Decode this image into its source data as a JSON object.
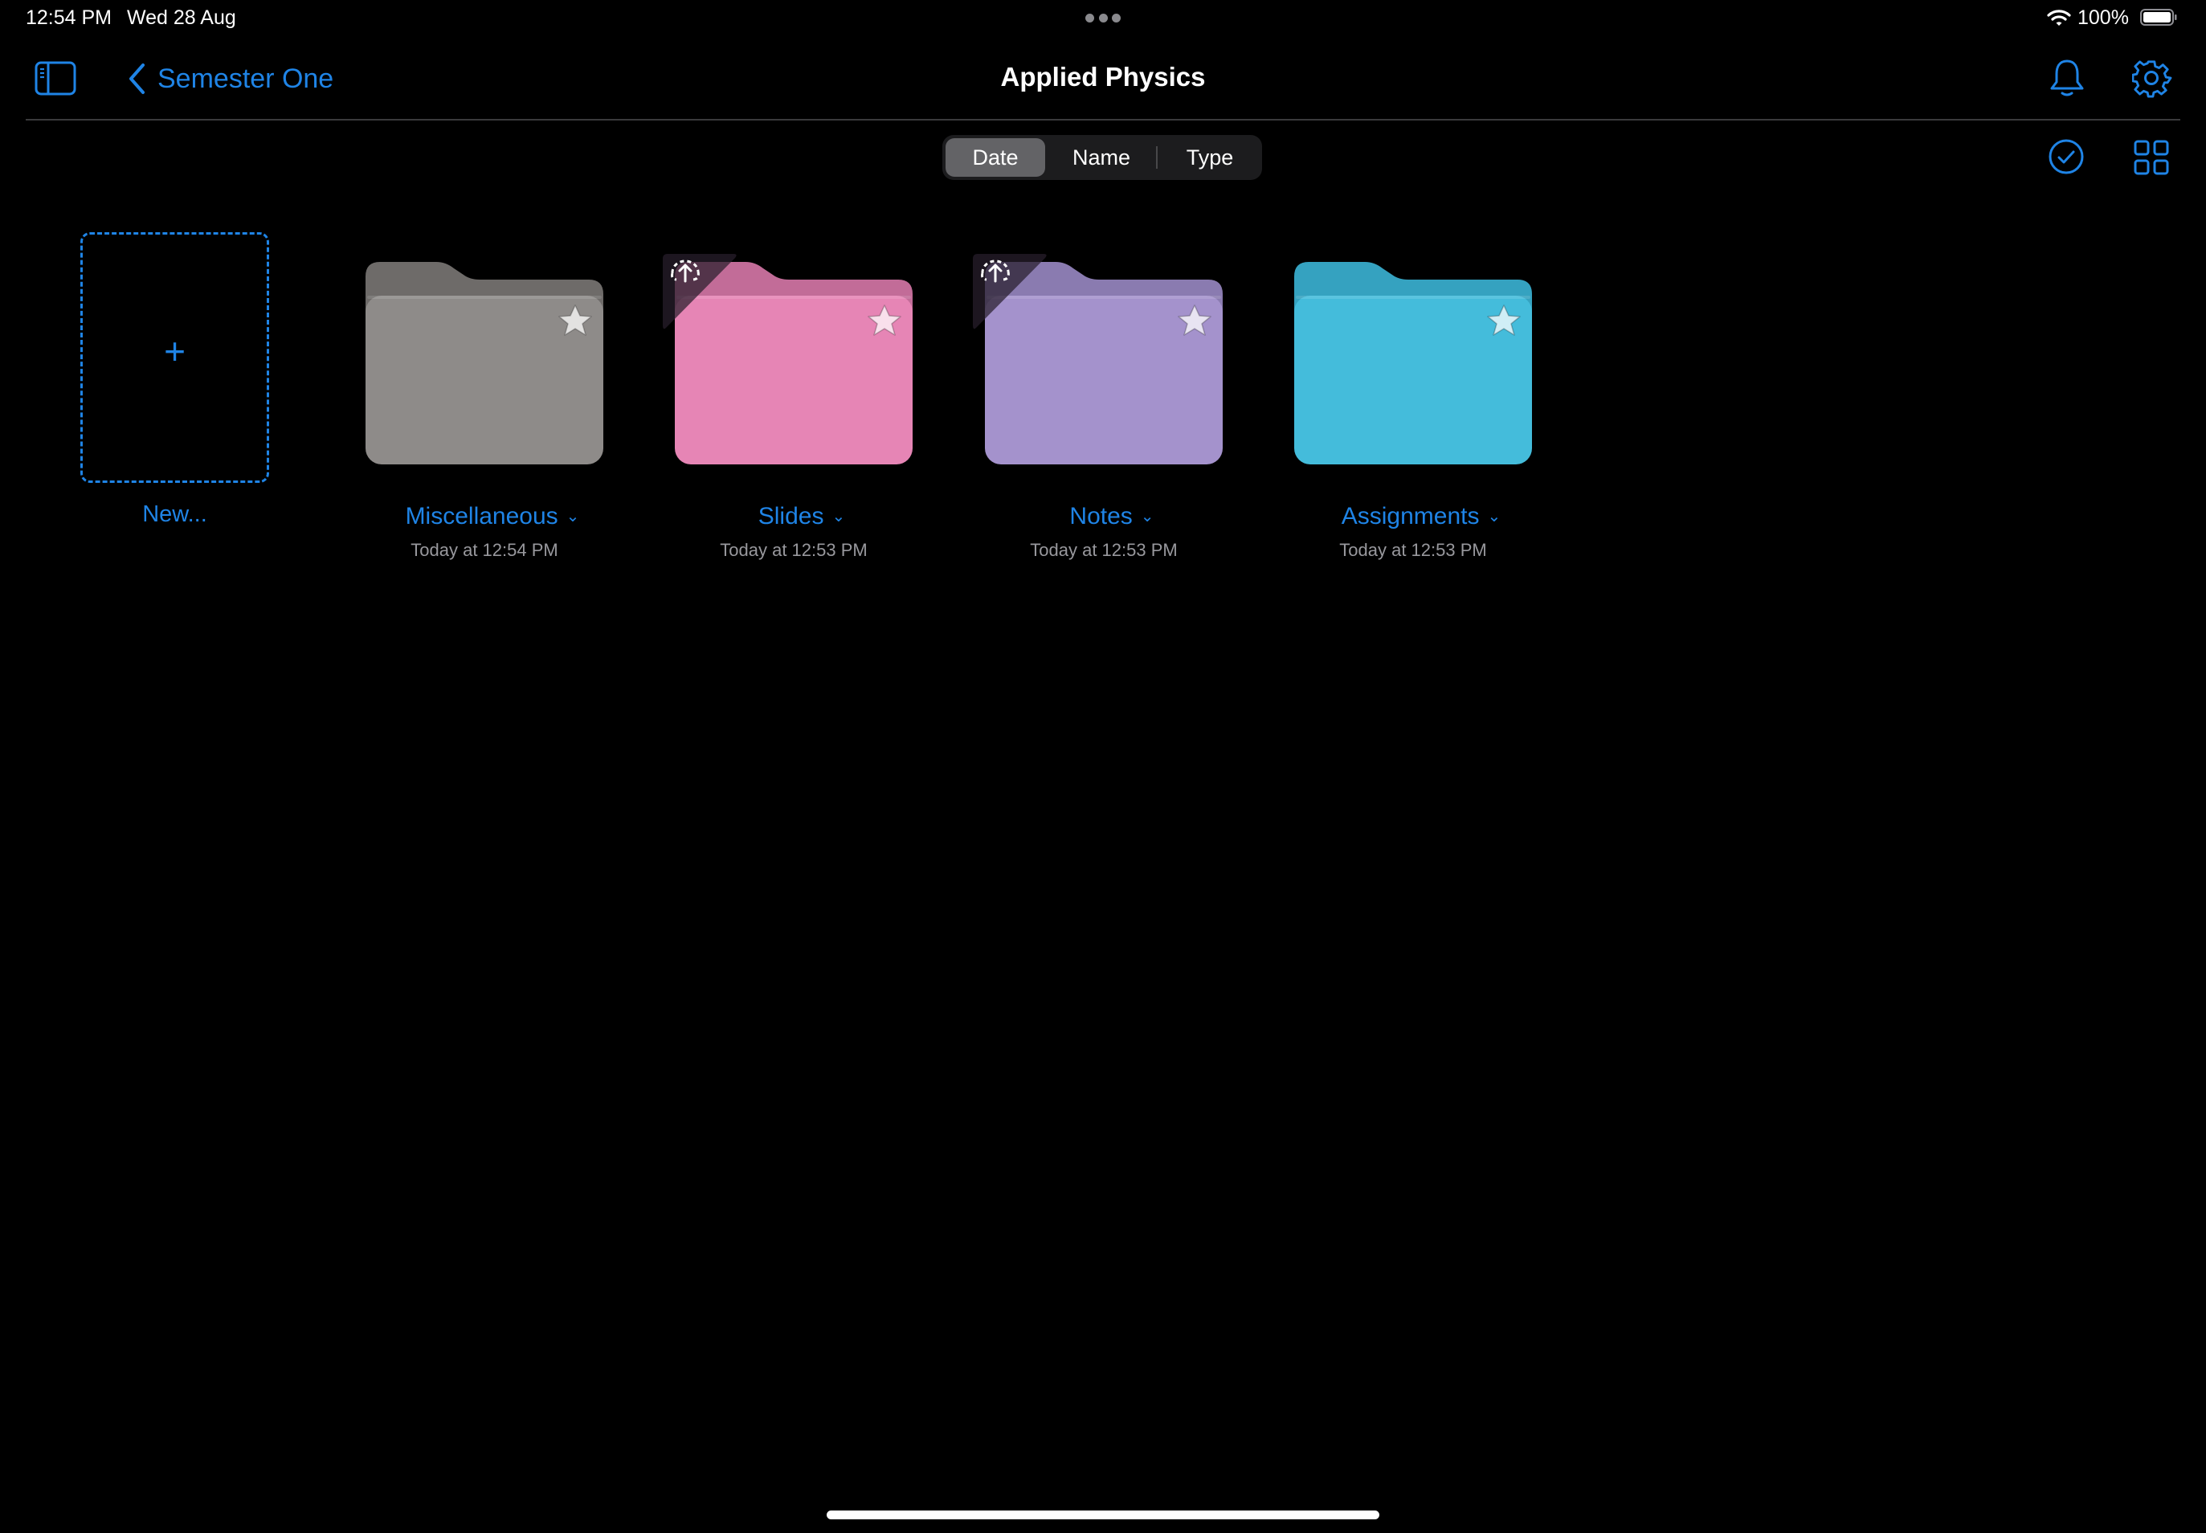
{
  "status_bar": {
    "time": "12:54 PM",
    "date": "Wed 28 Aug",
    "battery": "100%",
    "icons": [
      "multitasking-dots-icon",
      "wifi-icon",
      "battery-icon"
    ]
  },
  "nav": {
    "back_label": "Semester One",
    "title": "Applied Physics",
    "icons": [
      "sidebar-toggle-icon",
      "chevron-left-icon",
      "bell-icon",
      "gear-icon"
    ]
  },
  "toolbar": {
    "sort_options": [
      "Date",
      "Name",
      "Type"
    ],
    "sort_selected": "Date",
    "icons": [
      "checkmark-circle-icon",
      "grid-view-icon"
    ]
  },
  "new_tile": {
    "plus": "+",
    "label": "New..."
  },
  "folders": [
    {
      "name": "Miscellaneous",
      "date": "Today at 12:54 PM",
      "color": "#8e8b89",
      "back_color": "#6e6b69",
      "uploading": false,
      "starred": true
    },
    {
      "name": "Slides",
      "date": "Today at 12:53 PM",
      "color": "#e685b5",
      "back_color": "#c26c98",
      "uploading": true,
      "starred": true
    },
    {
      "name": "Notes",
      "date": "Today at 12:53 PM",
      "color": "#a492cc",
      "back_color": "#8a7bb0",
      "uploading": true,
      "starred": true
    },
    {
      "name": "Assignments",
      "date": "Today at 12:53 PM",
      "color": "#44bcdb",
      "back_color": "#35a2c0",
      "uploading": false,
      "starred": true
    }
  ],
  "colors": {
    "accent": "#1f84e6",
    "background": "#000000"
  }
}
